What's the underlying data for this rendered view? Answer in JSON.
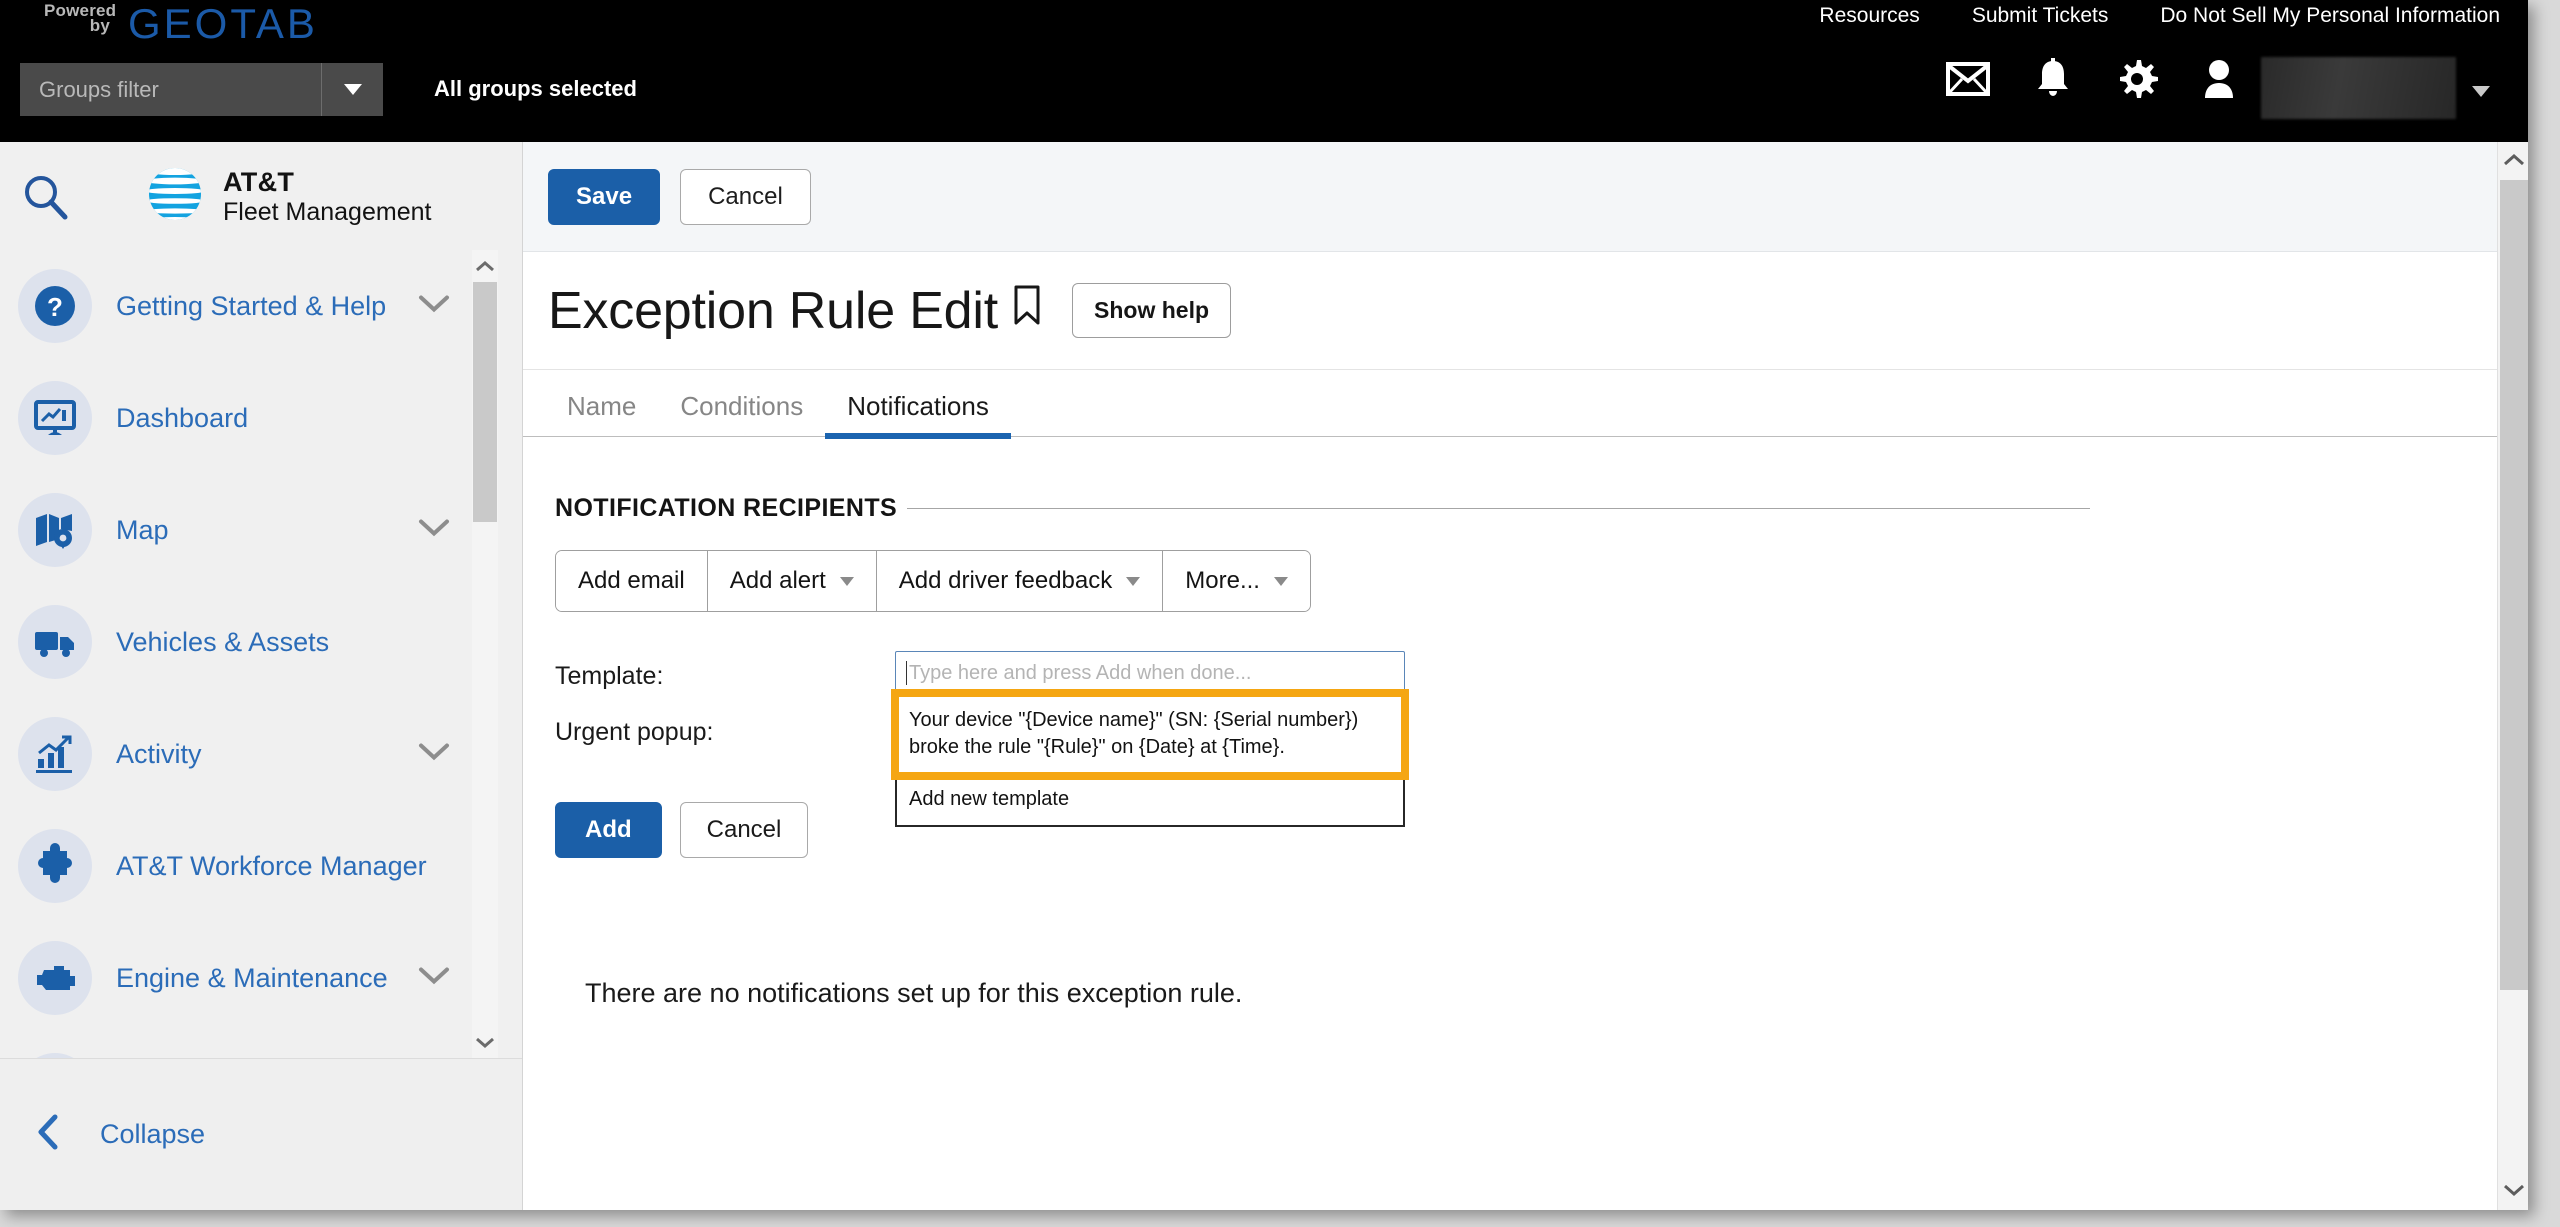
{
  "header": {
    "powered_by": "Powered\nby",
    "brand_logo": "GEOTAB",
    "nav": [
      {
        "label": "Resources"
      },
      {
        "label": "Submit Tickets"
      },
      {
        "label": "Do Not Sell My Personal Information"
      }
    ],
    "groups_filter_placeholder": "Groups filter",
    "groups_status": "All groups selected",
    "icons": [
      "mail-icon",
      "bell-icon",
      "gear-icon",
      "user-icon"
    ],
    "user_name": ""
  },
  "sidebar": {
    "search_icon": "search-icon",
    "brand_line1": "AT&T",
    "brand_line2": "Fleet Management",
    "items": [
      {
        "label": "Getting Started & Help",
        "icon": "help-circle-icon",
        "expandable": true
      },
      {
        "label": "Dashboard",
        "icon": "dashboard-icon",
        "expandable": false
      },
      {
        "label": "Map",
        "icon": "map-icon",
        "expandable": true
      },
      {
        "label": "Vehicles & Assets",
        "icon": "truck-icon",
        "expandable": false
      },
      {
        "label": "Activity",
        "icon": "chart-icon",
        "expandable": true
      },
      {
        "label": "AT&T Workforce Manager",
        "icon": "puzzle-icon",
        "expandable": false
      },
      {
        "label": "Engine & Maintenance",
        "icon": "engine-icon",
        "expandable": true
      }
    ],
    "collapse_label": "Collapse"
  },
  "toolbar": {
    "save_label": "Save",
    "cancel_label": "Cancel"
  },
  "page": {
    "title": "Exception Rule Edit",
    "bookmark_icon": "bookmark-icon",
    "show_help_label": "Show help",
    "tabs": [
      {
        "label": "Name",
        "active": false
      },
      {
        "label": "Conditions",
        "active": false
      },
      {
        "label": "Notifications",
        "active": true
      }
    ]
  },
  "notifications": {
    "section_title": "NOTIFICATION RECIPIENTS",
    "buttons": [
      {
        "label": "Add email",
        "has_caret": false
      },
      {
        "label": "Add alert",
        "has_caret": true
      },
      {
        "label": "Add driver feedback",
        "has_caret": true
      },
      {
        "label": "More...",
        "has_caret": true
      }
    ],
    "template_label": "Template:",
    "urgent_popup_label": "Urgent popup:",
    "template_placeholder": "Type here and press Add when done...",
    "template_value": "",
    "dropdown_options": [
      {
        "label": "Your device \"{Device name}\" (SN: {Serial number}) broke the rule \"{Rule}\" on {Date} at {Time}.",
        "highlighted": true
      },
      {
        "label": "Add new template",
        "highlighted": false
      }
    ],
    "add_label": "Add",
    "cancel_label": "Cancel",
    "empty_message": "There are no notifications set up for this exception rule."
  },
  "colors": {
    "brand_blue": "#1b5fa8",
    "geotab_blue": "#1b5aa8",
    "link_blue": "#2b6cb8",
    "highlight_orange": "#f5a612",
    "topbar_black": "#000000",
    "sidebar_grey": "#f0f0f0"
  }
}
